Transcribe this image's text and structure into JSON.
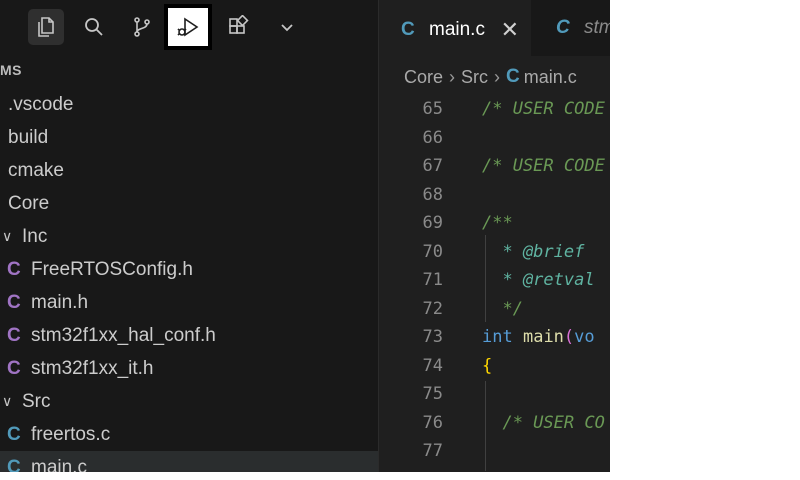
{
  "activity_bar": {
    "items": [
      {
        "name": "explorer",
        "icon": "files-icon",
        "active": true
      },
      {
        "name": "search",
        "icon": "search-icon"
      },
      {
        "name": "source-control",
        "icon": "source-control-icon"
      },
      {
        "name": "run-and-debug",
        "icon": "run-debug-icon",
        "highlighted": true
      },
      {
        "name": "extensions",
        "icon": "extensions-icon"
      },
      {
        "name": "more",
        "icon": "chevron-down-icon"
      }
    ]
  },
  "explorer": {
    "section_header": "MS",
    "tree": [
      {
        "label": ".vscode",
        "type": "folder"
      },
      {
        "label": "build",
        "type": "folder"
      },
      {
        "label": "cmake",
        "type": "folder"
      },
      {
        "label": "Core",
        "type": "folder"
      },
      {
        "label": "Inc",
        "type": "folder-open"
      },
      {
        "label": "FreeRTOSConfig.h",
        "type": "header",
        "icon_letter": "C"
      },
      {
        "label": "main.h",
        "type": "header",
        "icon_letter": "C"
      },
      {
        "label": "stm32f1xx_hal_conf.h",
        "type": "header",
        "icon_letter": "C"
      },
      {
        "label": "stm32f1xx_it.h",
        "type": "header",
        "icon_letter": "C"
      },
      {
        "label": "Src",
        "type": "folder-open"
      },
      {
        "label": "freertos.c",
        "type": "source",
        "icon_letter": "C"
      },
      {
        "label": "main.c",
        "type": "source",
        "icon_letter": "C",
        "selected": true
      }
    ]
  },
  "editor": {
    "tabs": [
      {
        "label": "main.c",
        "icon_letter": "C",
        "active": true,
        "close": "✕"
      },
      {
        "label": "stm",
        "icon_letter": "C",
        "active": false
      }
    ],
    "breadcrumb": [
      "Core",
      "Src",
      "main.c"
    ],
    "breadcrumb_sep": "›",
    "breadcrumb_icon": "C",
    "lines": [
      {
        "num": "65",
        "text": "/* USER CODE"
      },
      {
        "num": "66",
        "text": ""
      },
      {
        "num": "67",
        "text": "/* USER CODE"
      },
      {
        "num": "68",
        "text": ""
      },
      {
        "num": "69",
        "text": "/**"
      },
      {
        "num": "70",
        "text": "  * @brief"
      },
      {
        "num": "71",
        "text": "  * @retval"
      },
      {
        "num": "72",
        "text": "  */"
      },
      {
        "num": "73",
        "text": "int main(vo"
      },
      {
        "num": "74",
        "text": "{"
      },
      {
        "num": "75",
        "text": ""
      },
      {
        "num": "76",
        "text": "  /* USER CO"
      },
      {
        "num": "77",
        "text": ""
      }
    ]
  },
  "colors": {
    "sidebar_bg": "#181818",
    "editor_bg": "#1f1f1f",
    "c_header_icon": "#a074c4",
    "c_source_icon": "#519aba",
    "comment": "#6a9955",
    "keyword": "#569cd6",
    "function": "#dcdcaa"
  }
}
